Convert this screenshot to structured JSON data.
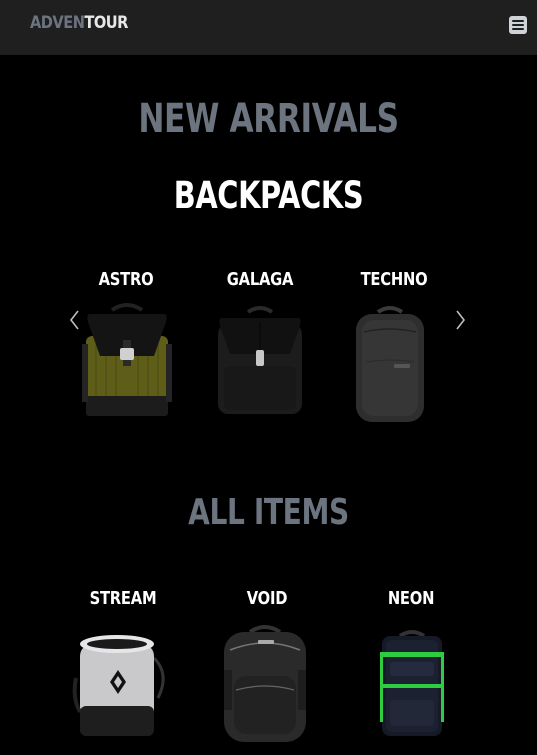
{
  "header": {
    "logo_part1": "ADVEN",
    "logo_part2": "TOUR",
    "menu_icon": "hamburger-icon"
  },
  "sections": {
    "new_arrivals_title": "NEW ARRIVALS",
    "backpacks_title": "BACKPACKS",
    "all_items_title": "ALL ITEMS"
  },
  "carousel": {
    "prev_icon": "chevron-left-icon",
    "next_icon": "chevron-right-icon",
    "items": [
      {
        "name": "ASTRO",
        "icon": "olive-backpack-icon"
      },
      {
        "name": "GALAGA",
        "icon": "black-backpack-icon"
      },
      {
        "name": "TECHNO",
        "icon": "grey-backpack-icon"
      }
    ]
  },
  "all_items": [
    {
      "name": "STREAM",
      "icon": "chalk-bag-icon"
    },
    {
      "name": "VOID",
      "icon": "daypack-icon"
    },
    {
      "name": "NEON",
      "icon": "neon-backpack-icon"
    }
  ],
  "colors": {
    "background": "#000000",
    "navbar": "#1f1f1f",
    "muted_heading": "#6c7480",
    "olive": "#6b6a1c",
    "neon_accent": "#2ecc40"
  }
}
